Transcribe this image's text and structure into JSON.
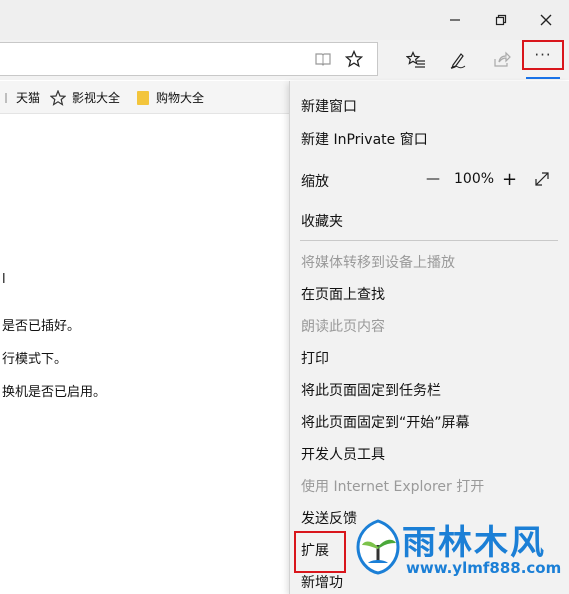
{
  "favorites": [
    {
      "label": "天猫",
      "icon": "site-icon"
    },
    {
      "label": "影视大全",
      "icon": "star-outline-icon"
    },
    {
      "label": "购物大全",
      "icon": "folder-icon"
    }
  ],
  "content_lines": [
    "l",
    "是否已插好。",
    "行模式下。",
    "换机是否已启用。"
  ],
  "menu": {
    "new_window": "新建窗口",
    "new_inprivate": "新建 InPrivate 窗口",
    "zoom_label": "缩放",
    "zoom_minus": "—",
    "zoom_value": "100%",
    "zoom_plus": "+",
    "favorites": "收藏夹",
    "cast_media": "将媒体转移到设备上播放",
    "find_on_page": "在页面上查找",
    "read_aloud": "朗读此页内容",
    "print": "打印",
    "pin_taskbar": "将此页面固定到任务栏",
    "pin_start": "将此页面固定到“开始”屏幕",
    "dev_tools": "开发人员工具",
    "open_ie": "使用 Internet Explorer 打开",
    "send_feedback": "发送反馈",
    "extensions": "扩展",
    "whats_new": "新增功"
  },
  "watermark": {
    "title": "雨林木风",
    "url": "www.ylmf888.com"
  },
  "colors": {
    "highlight_border": "#d9161c",
    "accent": "#1a73e8",
    "watermark": "#1b7fd6"
  }
}
